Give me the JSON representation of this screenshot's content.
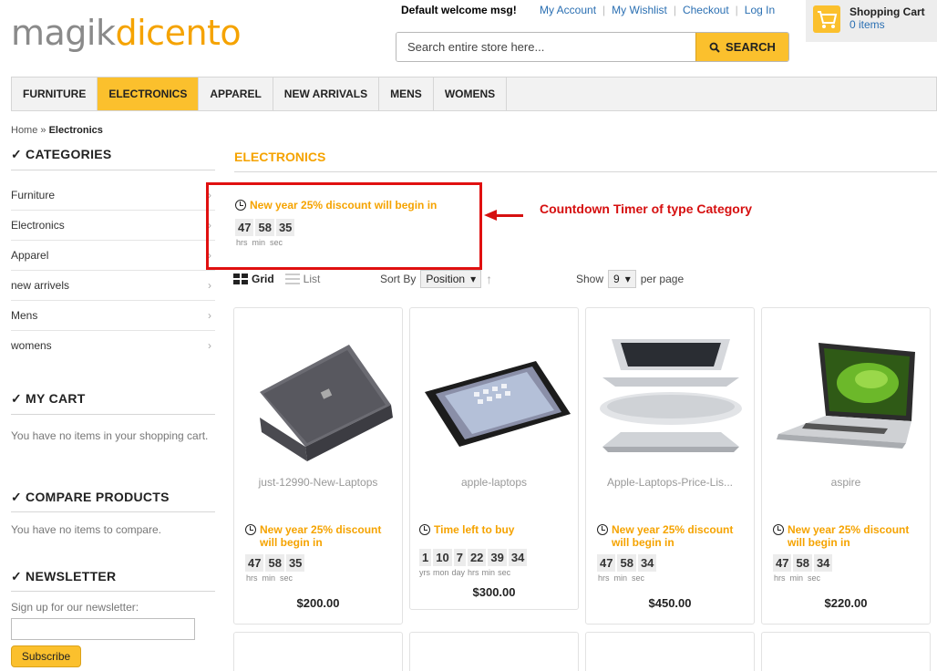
{
  "logo": {
    "part1": "magik",
    "part2": "dicento"
  },
  "header": {
    "welcome": "Default welcome msg!",
    "links": [
      "My Account",
      "My Wishlist",
      "Checkout",
      "Log In"
    ],
    "search_placeholder": "Search entire store here...",
    "search_button": "SEARCH",
    "cart_title": "Shopping Cart",
    "cart_count": "0 items"
  },
  "nav": [
    "FURNITURE",
    "ELECTRONICS",
    "APPAREL",
    "NEW ARRIVALS",
    "MENS",
    "WOMENS"
  ],
  "nav_active": "ELECTRONICS",
  "breadcrumb": {
    "home": "Home",
    "sep": "»",
    "current": "Electronics"
  },
  "sidebar": {
    "categories_heading": "CATEGORIES",
    "categories": [
      "Furniture",
      "Electronics",
      "Apparel",
      "new arrivels",
      "Mens",
      "womens"
    ],
    "mycart_heading": "MY CART",
    "mycart_text": "You have no items in your shopping cart.",
    "compare_heading": "COMPARE PRODUCTS",
    "compare_text": "You have no items to compare.",
    "newsletter_heading": "NEWSLETTER",
    "newsletter_text": "Sign up for our newsletter:",
    "subscribe": "Subscribe"
  },
  "main": {
    "title": "ELECTRONICS",
    "category_timer": {
      "title": "New year 25% discount will begin in",
      "values": [
        "47",
        "58",
        "35"
      ],
      "units": [
        "hrs",
        "min",
        "sec"
      ]
    },
    "annotation": "Countdown Timer of type Category",
    "view": {
      "grid": "Grid",
      "list": "List"
    },
    "sort": {
      "label": "Sort By",
      "value": "Position"
    },
    "show": {
      "label": "Show",
      "value": "9",
      "suffix": "per page"
    }
  },
  "products": [
    {
      "name": "just-12990-New-Laptops",
      "timer_title": "New year 25% discount will begin in",
      "values": [
        "47",
        "58",
        "35"
      ],
      "units": [
        "hrs",
        "min",
        "sec"
      ],
      "price": "$200.00"
    },
    {
      "name": "apple-laptops",
      "timer_title": "Time left to buy",
      "values": [
        "1",
        "10",
        "7",
        "22",
        "39",
        "34"
      ],
      "units": [
        "yrs",
        "mon",
        "day",
        "hrs",
        "min",
        "sec"
      ],
      "price": "$300.00"
    },
    {
      "name": "Apple-Laptops-Price-Lis...",
      "timer_title": "New year 25% discount will begin in",
      "values": [
        "47",
        "58",
        "34"
      ],
      "units": [
        "hrs",
        "min",
        "sec"
      ],
      "price": "$450.00"
    },
    {
      "name": "aspire",
      "timer_title": "New year 25% discount will begin in",
      "values": [
        "47",
        "58",
        "34"
      ],
      "units": [
        "hrs",
        "min",
        "sec"
      ],
      "price": "$220.00"
    }
  ],
  "colors": {
    "accent": "#fbc02d",
    "orange_text": "#f5a300",
    "link": "#2a6fb2",
    "annotation": "#d61010"
  }
}
